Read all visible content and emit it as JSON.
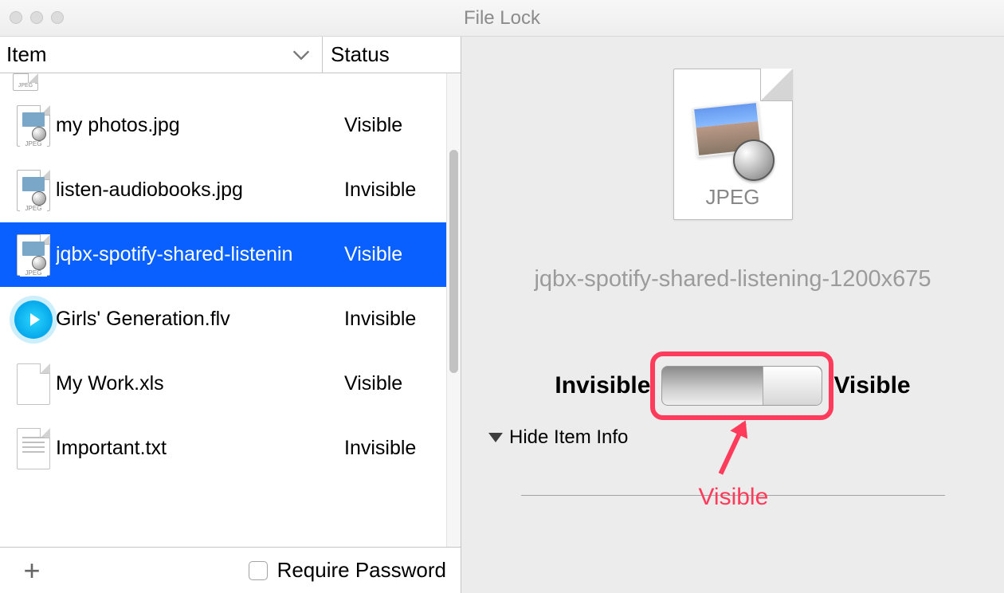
{
  "window": {
    "title": "File Lock"
  },
  "columns": {
    "item": "Item",
    "status": "Status"
  },
  "rows": [
    {
      "name": "my photos.jpg",
      "status": "Visible",
      "icon": "jpeg"
    },
    {
      "name": "listen-audiobooks.jpg",
      "status": "Invisible",
      "icon": "jpeg"
    },
    {
      "name": "jqbx-spotify-shared-listenin",
      "status": "Visible",
      "icon": "jpeg",
      "selected": true
    },
    {
      "name": "Girls' Generation.flv",
      "status": "Invisible",
      "icon": "flv"
    },
    {
      "name": "My Work.xls",
      "status": "Visible",
      "icon": "blank"
    },
    {
      "name": "Important.txt",
      "status": "Invisible",
      "icon": "txt"
    }
  ],
  "peek_tag": "JPEG",
  "footer": {
    "require_password": "Require Password"
  },
  "detail": {
    "kind": "JPEG",
    "filename": "jqbx-spotify-shared-listening-1200x675",
    "invisible": "Invisible",
    "visible": "Visible",
    "hide_info": "Hide Item Info"
  },
  "annotation": {
    "label": "Visible",
    "color": "#ff3b5c"
  }
}
